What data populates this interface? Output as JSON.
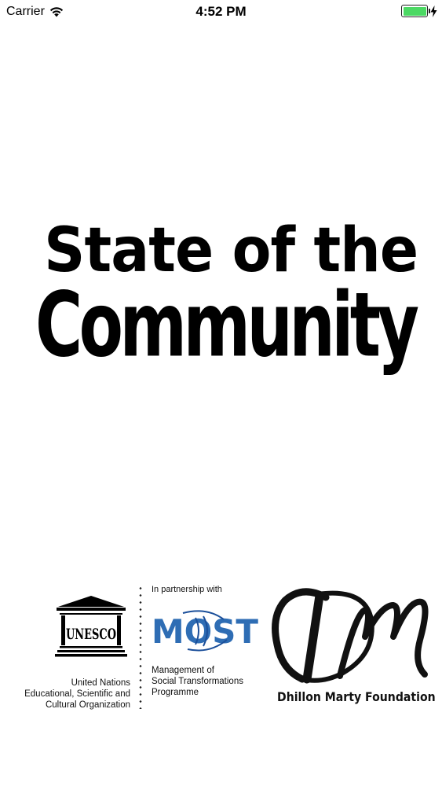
{
  "status_bar": {
    "carrier": "Carrier",
    "time": "4:52 PM",
    "battery_level": 1.0,
    "battery_color": "#4cd964"
  },
  "splash": {
    "title_line_1": "State of the",
    "title_line_2": "Community"
  },
  "partners": {
    "unesco": {
      "wordmark": "UNESCO",
      "caption_lines": [
        "United Nations",
        "Educational, Scientific and",
        "Cultural Organization"
      ]
    },
    "most": {
      "intro": "In partnership with",
      "wordmark": "MOST",
      "caption_lines": [
        "Management of",
        "Social Transformations",
        "Programme"
      ],
      "brand_color": "#2e6db4"
    },
    "dhillon_marty": {
      "monogram": "DM",
      "name": "Dhillon Marty Foundation"
    }
  }
}
